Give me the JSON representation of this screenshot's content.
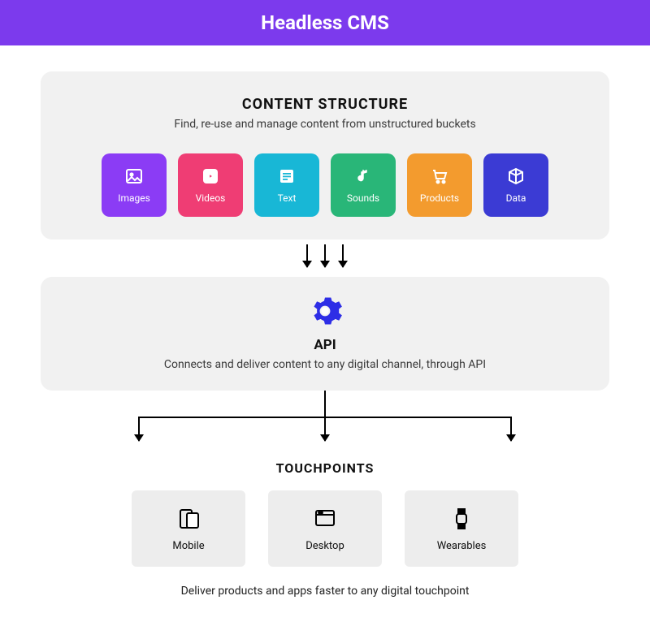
{
  "banner": {
    "title": "Headless CMS"
  },
  "content": {
    "title": "CONTENT STRUCTURE",
    "subtitle": "Find, re-use  and manage content from unstructured buckets",
    "tiles": [
      {
        "label": "Images",
        "color": "#8b3cf5"
      },
      {
        "label": "Videos",
        "color": "#ef3d74"
      },
      {
        "label": "Text",
        "color": "#18b7d6"
      },
      {
        "label": "Sounds",
        "color": "#29b678"
      },
      {
        "label": "Products",
        "color": "#f39b2e"
      },
      {
        "label": "Data",
        "color": "#3b3bd4"
      }
    ]
  },
  "api": {
    "title": "API",
    "subtitle": "Connects and deliver content to any digital channel, through API",
    "gear_color": "#2e2ee6"
  },
  "touchpoints": {
    "title": "TOUCHPOINTS",
    "items": [
      {
        "label": "Mobile"
      },
      {
        "label": "Desktop"
      },
      {
        "label": "Wearables"
      }
    ],
    "footer": "Deliver products and apps faster to any digital touchpoint"
  }
}
